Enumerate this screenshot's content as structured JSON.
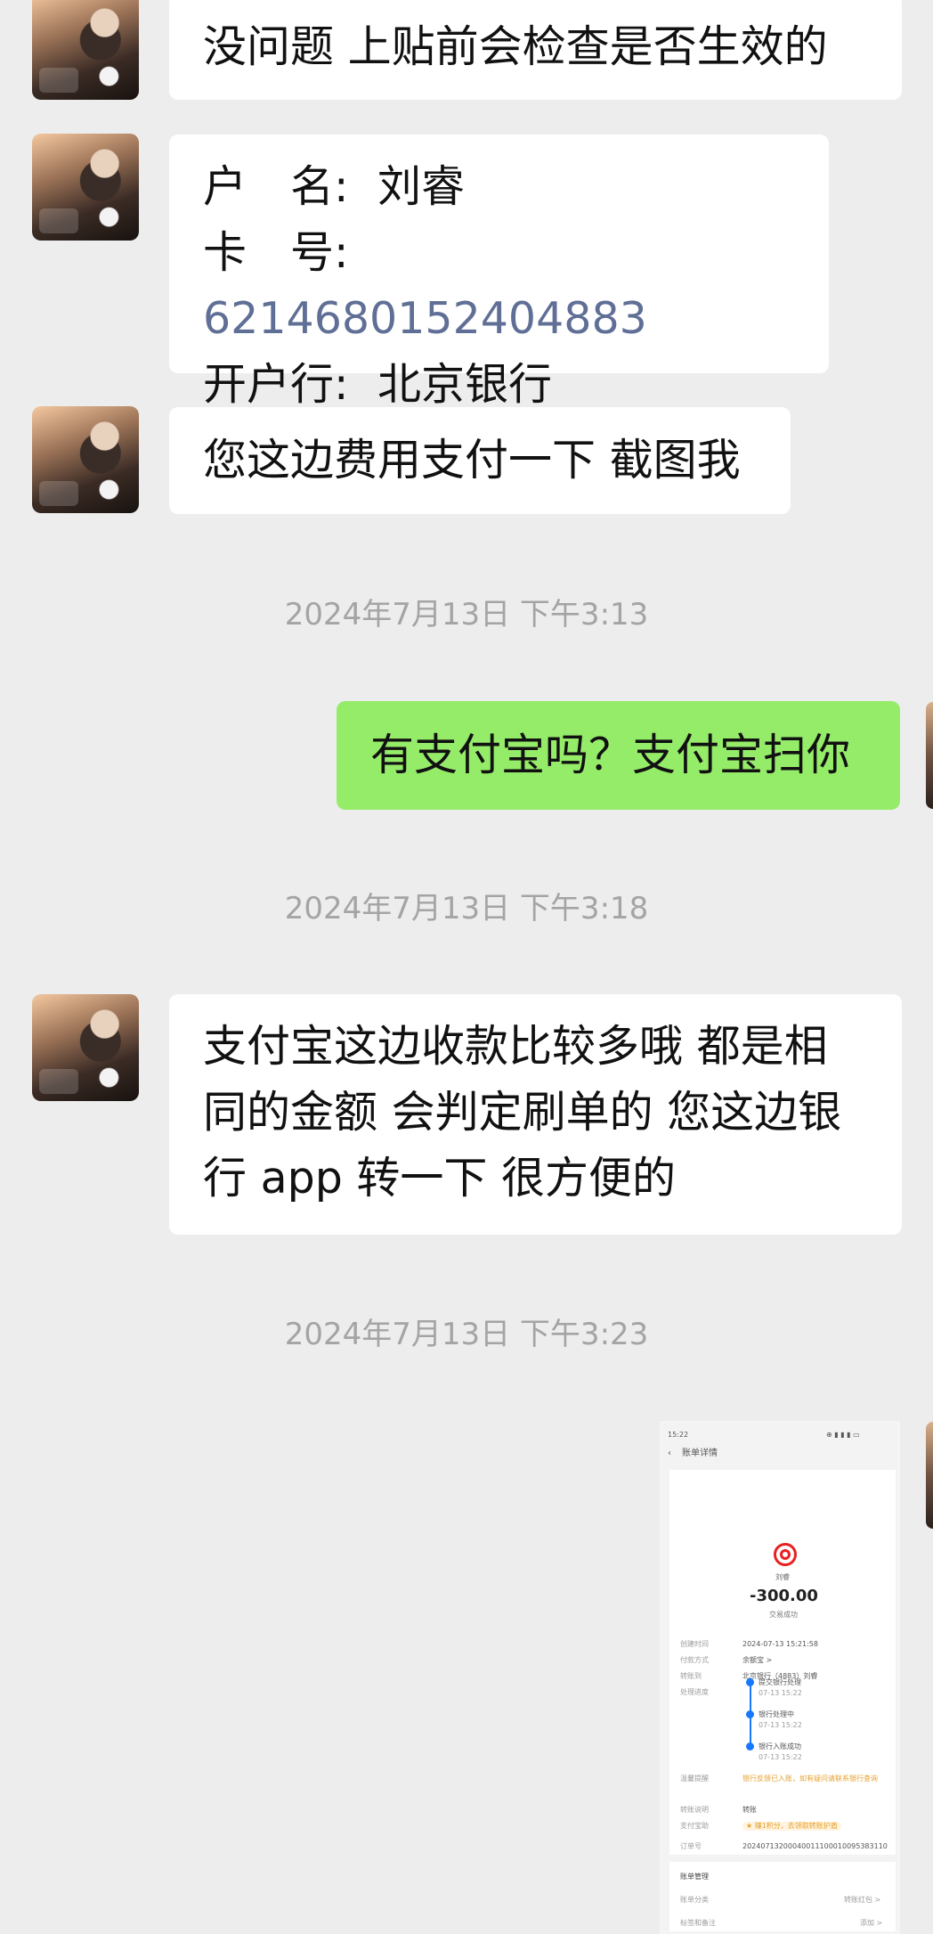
{
  "messages": {
    "m1_text": "没问题 上贴前会检查是否生效的",
    "m2": {
      "name_label": "户　名:",
      "name_value": "刘睿",
      "card_label": "卡　号:",
      "card_value": "6214680152404883",
      "bank_label": "开户行:",
      "bank_value": "北京银行"
    },
    "m3_text": "您这边费用支付一下 截图我",
    "ts1": "2024年7月13日 下午3:13",
    "m4_text": "有支付宝吗？支付宝扫你",
    "ts2": "2024年7月13日 下午3:18",
    "m5_lines": [
      "支付宝这边收款比较多哦  都是相",
      "同的金额 会判定刷单的  您这边银",
      "行 app 转一下 很方便的"
    ],
    "ts3": "2024年7月13日 下午3:23"
  },
  "screenshot": {
    "status_time": "15:22",
    "status_icons": "⊕ ▮ ▮ ▮ ▭",
    "header": "账单详情",
    "bank_name_under_logo": "刘睿",
    "amount": "-300.00",
    "status": "交易成功",
    "rows": {
      "created_label": "创建时间",
      "created_value": "2024-07-13 15:21:58",
      "payment_label": "付款方式",
      "payment_value": "余额宝 >",
      "transfer_to_label": "转账到",
      "transfer_to_value": "北京银行（4883）刘睿",
      "progress_label": "处理进度",
      "step1": "提交银行处理",
      "step1_time": "07-13 15:22",
      "step2": "银行处理中",
      "step2_time": "07-13 15:22",
      "step3": "银行入账成功",
      "step3_time": "07-13 15:22",
      "notice_label": "温馨提醒",
      "notice_value": "银行反馈已入账，如有疑问请联系银行查询",
      "purpose_label": "转账说明",
      "purpose_value": "转账",
      "guarantee_label": "支付宝助",
      "guarantee_value": "★ 赚1积分，去领取转账护盾",
      "order_label": "订单号",
      "order_value": "20240713200040011100010095383110"
    },
    "manage_title": "账单管理",
    "category_label": "账单分类",
    "category_value": "转账红包 >",
    "tag_label": "标签和备注",
    "tag_value": "添加 >"
  }
}
